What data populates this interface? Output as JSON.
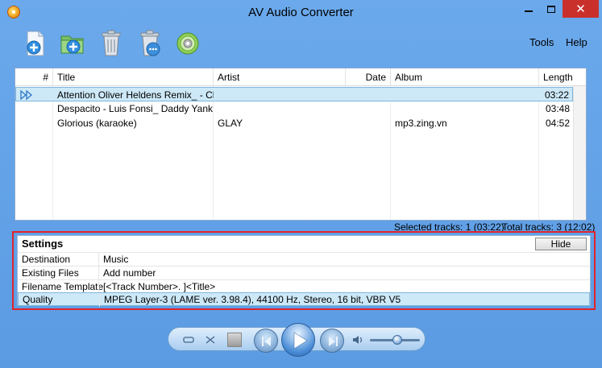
{
  "window": {
    "title": "AV Audio Converter",
    "close_glyph": "✕"
  },
  "menu": {
    "tools": "Tools",
    "help": "Help"
  },
  "toolbar": {
    "icons": [
      "add-file-icon",
      "add-folder-icon",
      "delete-icon",
      "delete-all-icon",
      "convert-icon"
    ]
  },
  "table": {
    "columns": {
      "index": "#",
      "title": "Title",
      "artist": "Artist",
      "date": "Date",
      "album": "Album",
      "length": "Length"
    },
    "rows": [
      {
        "title": "Attention Oliver Heldens Remix_ - Ch...",
        "artist": "",
        "date": "",
        "album": "",
        "length": "03:22",
        "selected": true
      },
      {
        "title": "Despacito - Luis Fonsi_ Daddy Yank...",
        "artist": "",
        "date": "",
        "album": "",
        "length": "03:48",
        "selected": false
      },
      {
        "title": "Glorious (karaoke)",
        "artist": "GLAY",
        "date": "",
        "album": "mp3.zing.vn",
        "length": "04:52",
        "selected": false
      }
    ]
  },
  "status": {
    "selected": "Selected tracks: 1 (03:22)",
    "total": "Total tracks: 3 (12:02)"
  },
  "settings": {
    "title": "Settings",
    "hide_label": "Hide",
    "rows": [
      {
        "label": "Destination",
        "value": "Music"
      },
      {
        "label": "Existing Files",
        "value": "Add number"
      },
      {
        "label": "Filename Template",
        "value": "[<Track Number>. ]<Title>"
      },
      {
        "label": "Quality",
        "value": "MPEG Layer-3 (LAME ver. 3.98.4), 44100 Hz, Stereo, 16 bit, VBR V5"
      }
    ],
    "selected_row": "Quality"
  },
  "player": {
    "volume_level": 0.5
  },
  "colors": {
    "window_bg": "#5fa0e6",
    "selection": "#cde8f7",
    "highlight_border": "#e0242c",
    "close_button": "#c9302c"
  }
}
